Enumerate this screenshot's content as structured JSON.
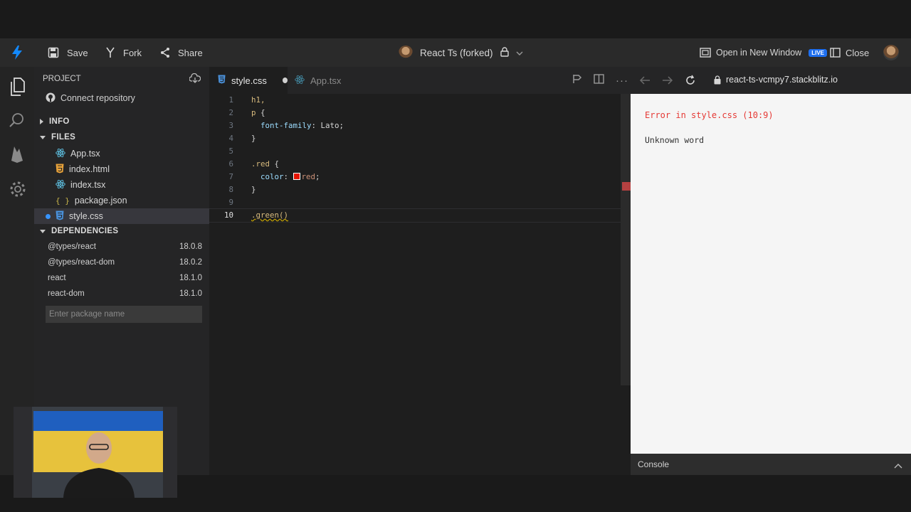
{
  "toolbar": {
    "save_label": "Save",
    "fork_label": "Fork",
    "share_label": "Share",
    "project_title": "React Ts (forked)",
    "open_new_window_label": "Open in New Window",
    "live_badge": "LIVE",
    "close_label": "Close"
  },
  "sidebar": {
    "project_header": "PROJECT",
    "connect_repo": "Connect repository",
    "info_header": "INFO",
    "files_header": "FILES",
    "files": [
      {
        "name": "App.tsx",
        "icon": "react-icon"
      },
      {
        "name": "index.html",
        "icon": "html5-icon"
      },
      {
        "name": "index.tsx",
        "icon": "react-icon"
      },
      {
        "name": "package.json",
        "icon": "json-braces-icon"
      },
      {
        "name": "style.css",
        "icon": "css3-icon"
      }
    ],
    "dependencies_header": "DEPENDENCIES",
    "dependencies": [
      {
        "name": "@types/react",
        "version": "18.0.8"
      },
      {
        "name": "@types/react-dom",
        "version": "18.0.2"
      },
      {
        "name": "react",
        "version": "18.1.0"
      },
      {
        "name": "react-dom",
        "version": "18.1.0"
      }
    ],
    "package_placeholder": "Enter package name"
  },
  "tabs": [
    {
      "label": "style.css",
      "active": true,
      "modified": true
    },
    {
      "label": "App.tsx",
      "active": false,
      "modified": false
    }
  ],
  "editor": {
    "line_numbers": [
      "1",
      "2",
      "3",
      "4",
      "5",
      "6",
      "7",
      "8",
      "9",
      "10"
    ],
    "lines": {
      "l1": "h1,",
      "l2_sel": "p",
      "l2_rest": " {",
      "l3_prop": "  font-family",
      "l3_rest": ": Lato;",
      "l4": "}",
      "l6_sel": ".red",
      "l6_rest": " {",
      "l7_prop": "  color",
      "l7_colon": ": ",
      "l7_val": "red",
      "l7_end": ";",
      "l8": "}",
      "l10": ".green()"
    }
  },
  "preview": {
    "url": "react-ts-vcmpy7.stackblitz.io",
    "error_title": "Error in style.css (10:9)",
    "error_message": "Unknown word",
    "console_label": "Console"
  },
  "colors": {
    "accent": "#3794ff",
    "error": "#e53935",
    "live_badge": "#1e6ff0"
  }
}
